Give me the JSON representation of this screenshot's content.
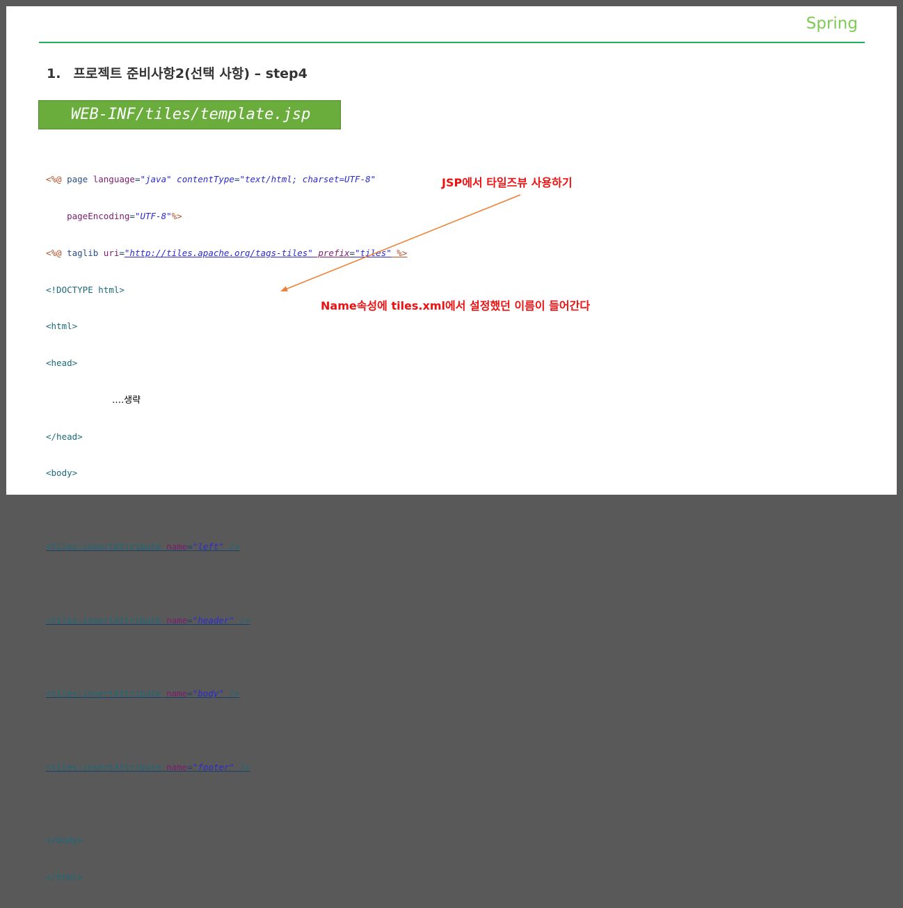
{
  "header": {
    "brand": "Spring"
  },
  "section": {
    "number": "1.",
    "title": "프로젝트 준비사항2(선택 사항) – step4"
  },
  "file_label": "WEB-INF/tiles/template.jsp",
  "code": {
    "l1_dir": "<%@",
    "l1_kw": " page ",
    "l1_attr1": "language",
    "l1_eq1": "=",
    "l1_val1": "\"java\"",
    "l1_attr2": " contentType",
    "l1_eq2": "=",
    "l1_val2": "\"text/html; charset=UTF-8\"",
    "l2_indent": "    ",
    "l2_attr": "pageEncoding",
    "l2_eq": "=",
    "l2_val": "\"UTF-8\"",
    "l2_end": "%>",
    "l3_dir": "<%@",
    "l3_kw": " taglib ",
    "l3_attr1": "uri",
    "l3_eq1": "=",
    "l3_val1": "\"http://tiles.apache.org/tags-tiles\"",
    "l3_attr2": " prefix",
    "l3_eq2": "=",
    "l3_val2": "\"tiles\"",
    "l3_end": " %>",
    "doctype": "<!DOCTYPE html>",
    "html_open": "<html>",
    "head_open": "<head>",
    "omitted": "….생략",
    "head_close": "</head>",
    "body_open": "<body>",
    "tiles": [
      {
        "tag": "<tiles:insertAttribute ",
        "attr": "name",
        "eq": "=",
        "value": "\"left\"",
        "end": " />"
      },
      {
        "tag": "<tiles:insertAttribute ",
        "attr": "name",
        "eq": "=",
        "value": "\"header\"",
        "end": " />"
      },
      {
        "tag": "<tiles:insertAttribute ",
        "attr": "name",
        "eq": "=",
        "value": "\"body\"",
        "end": " />"
      },
      {
        "tag": "<tiles:insertAttribute ",
        "attr": "name",
        "eq": "=",
        "value": "\"footer\"",
        "end": " />"
      }
    ],
    "body_close": "</body>",
    "html_close": "</html>"
  },
  "callouts": {
    "taglib_note": "JSP에서 타일즈뷰 사용하기",
    "name_note": "Name속성에 tiles.xml에서 설정했던 이름이 들어간다"
  },
  "colors": {
    "brand": "#7ccb52",
    "rule": "#1fae5a",
    "file_box": "#6aad3d",
    "callout": "#ee1111",
    "arrow": "#ed7d31"
  }
}
